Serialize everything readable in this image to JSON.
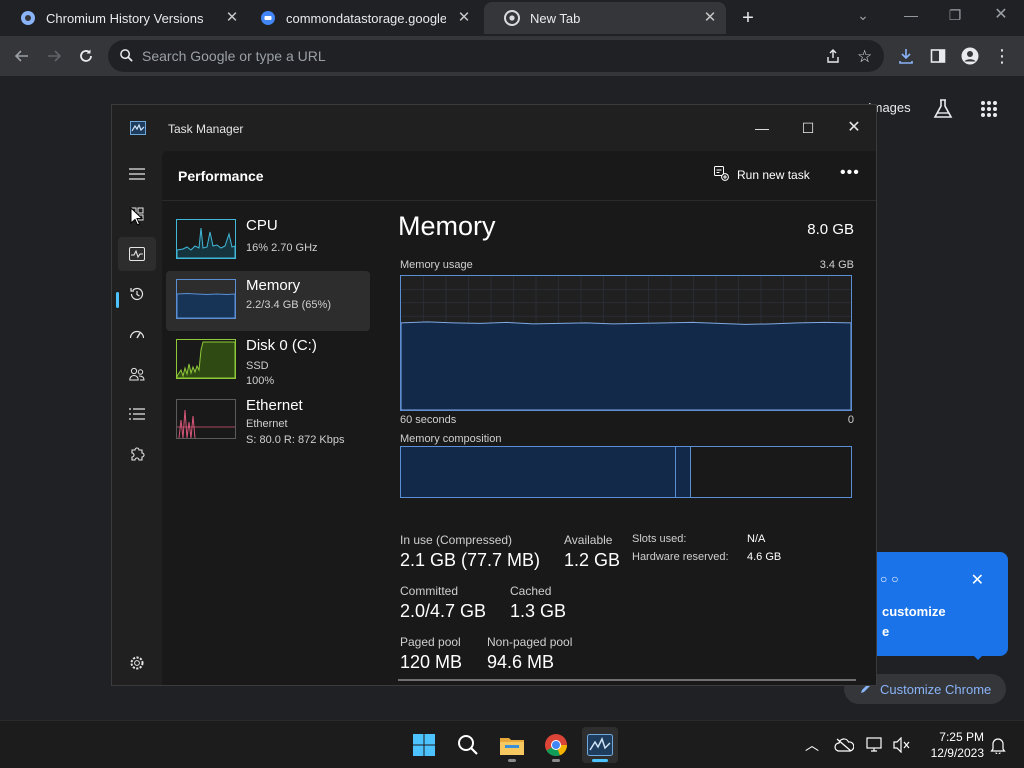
{
  "browser": {
    "tabs": [
      {
        "title": "Chromium History Versions Down",
        "favicon": "chromium-globe-icon",
        "active": false
      },
      {
        "title": "commondatastorage.googleapis.",
        "favicon": "cloud-storage-icon",
        "active": false
      },
      {
        "title": "New Tab",
        "favicon": "chrome-icon",
        "active": true
      }
    ],
    "omnibox_placeholder": "Search Google or type a URL",
    "ntp": {
      "images_link": "Images",
      "promo_text_1": "customize",
      "promo_text_2": "e",
      "customize_button": "Customize Chrome"
    }
  },
  "task_manager": {
    "title": "Task Manager",
    "section": "Performance",
    "run_new_task": "Run new task",
    "resources": [
      {
        "name": "CPU",
        "sub1": "16%  2.70 GHz",
        "sub2": "",
        "color": "#41b8d9"
      },
      {
        "name": "Memory",
        "sub1": "2.2/3.4 GB (65%)",
        "sub2": "",
        "color": "#5a8fd6"
      },
      {
        "name": "Disk 0 (C:)",
        "sub1": "SSD",
        "sub2": "100%",
        "color": "#8fc93a"
      },
      {
        "name": "Ethernet",
        "sub1": "Ethernet",
        "sub2": "S: 80.0  R: 872 Kbps",
        "color": "#d9577a"
      }
    ],
    "detail": {
      "title": "Memory",
      "total": "8.0 GB",
      "usage_label": "Memory usage",
      "usage_max": "3.4 GB",
      "time_left": "60 seconds",
      "time_right": "0",
      "composition_label": "Memory composition",
      "composition_in_use_fraction": 0.61,
      "composition_modified_fraction": 0.035,
      "usage_history_fraction": 0.65,
      "stats": [
        {
          "label": "In use (Compressed)",
          "value": "2.1 GB (77.7 MB)"
        },
        {
          "label": "Available",
          "value": "1.2 GB"
        },
        {
          "label": "Committed",
          "value": "2.0/4.7 GB"
        },
        {
          "label": "Cached",
          "value": "1.3 GB"
        },
        {
          "label": "Paged pool",
          "value": "120 MB"
        },
        {
          "label": "Non-paged pool",
          "value": "94.6 MB"
        }
      ],
      "kv": [
        {
          "key": "Slots used:",
          "value": "N/A"
        },
        {
          "key": "Hardware reserved:",
          "value": "4.6 GB"
        }
      ]
    }
  },
  "taskbar": {
    "time": "7:25 PM",
    "date": "12/9/2023"
  }
}
